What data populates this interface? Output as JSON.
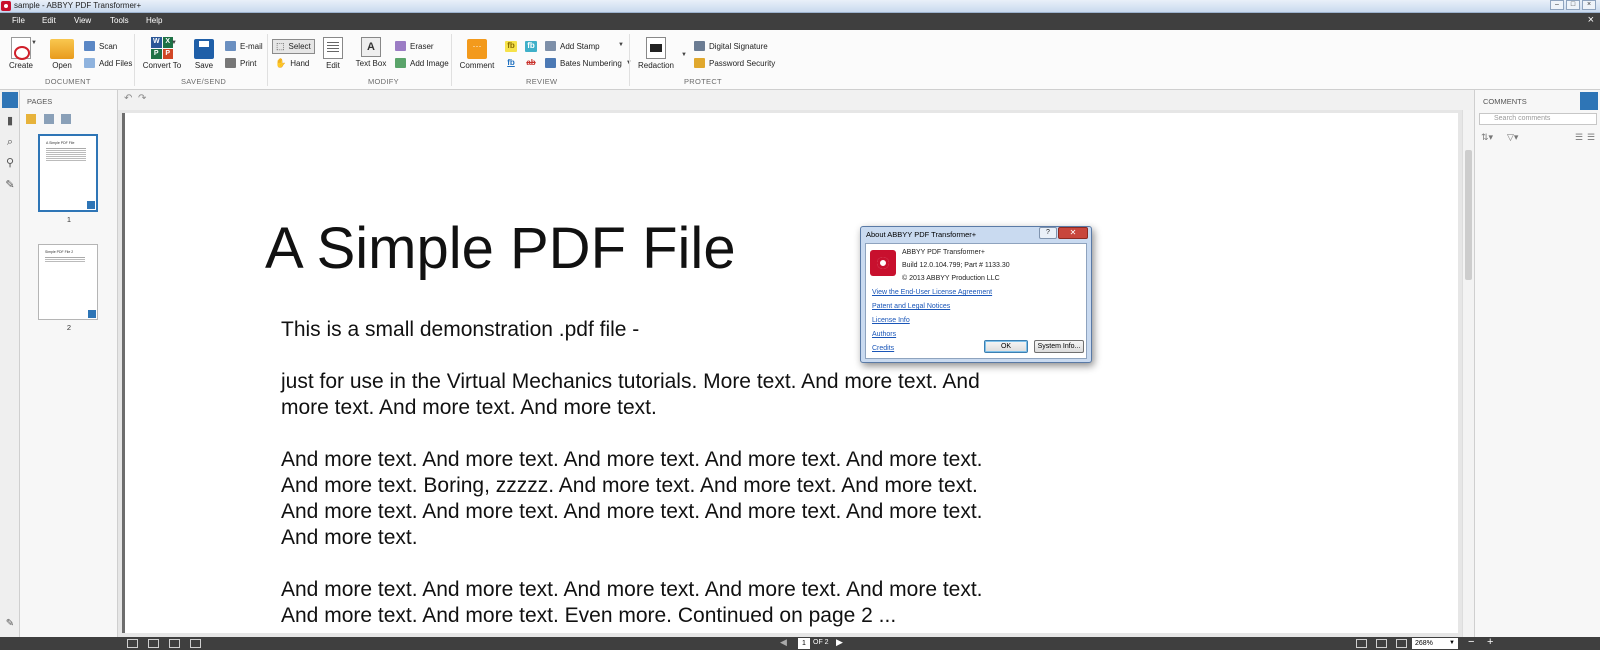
{
  "window": {
    "title": "sample - ABBYY PDF Transformer+"
  },
  "menu": [
    "File",
    "Edit",
    "View",
    "Tools",
    "Help"
  ],
  "ribbon": {
    "create": "Create",
    "open": "Open",
    "scan": "Scan",
    "add_files": "Add Files",
    "convert_to": "Convert To",
    "save": "Save",
    "email": "E-mail",
    "print": "Print",
    "select": "Select",
    "hand": "Hand",
    "edit": "Edit",
    "text_box": "Text Box",
    "eraser": "Eraser",
    "add_image": "Add Image",
    "comment": "Comment",
    "add_stamp": "Add Stamp",
    "bates_numbering": "Bates Numbering",
    "redaction": "Redaction",
    "digital_signature": "Digital Signature",
    "password_security": "Password Security",
    "groups": {
      "document": "DOCUMENT",
      "save_send": "SAVE/SEND",
      "modify": "MODIFY",
      "review": "REVIEW",
      "protect": "PROTECT"
    }
  },
  "pages_panel": {
    "header": "PAGES",
    "thumbs": [
      {
        "label": "1",
        "title": "A Simple PDF File"
      },
      {
        "label": "2",
        "title": "Simple PDF File 2"
      }
    ]
  },
  "document": {
    "title": "A Simple PDF File",
    "paragraphs": [
      "This is a small demonstration .pdf file -",
      "just for use in the Virtual Mechanics tutorials. More text. And more text. And more text. And more text. And more text.",
      "And more text. And more text. And more text. And more text. And more text. And more text. Boring, zzzzz. And more text. And more text. And more text. And more text. And more text. And more text. And more text. And more text. And more text.",
      "And more text. And more text. And more text. And more text. And more text. And more text. And more text. Even more. Continued on page 2 ..."
    ]
  },
  "comments_panel": {
    "header": "COMMENTS",
    "search_placeholder": "Search comments"
  },
  "statusbar": {
    "page": "1",
    "of": "OF 2",
    "zoom": "268%"
  },
  "dialog": {
    "title": "About ABBYY PDF Transformer+",
    "product": "ABBYY PDF Transformer+",
    "build": "Build 12.0.104.799; Part # 1133.30",
    "copyright": "© 2013 ABBYY Production LLC",
    "links": [
      "View the End-User License Agreement",
      "Patent and Legal Notices",
      "License Info",
      "Authors",
      "Credits"
    ],
    "ok": "OK",
    "system_info": "System Info..."
  }
}
